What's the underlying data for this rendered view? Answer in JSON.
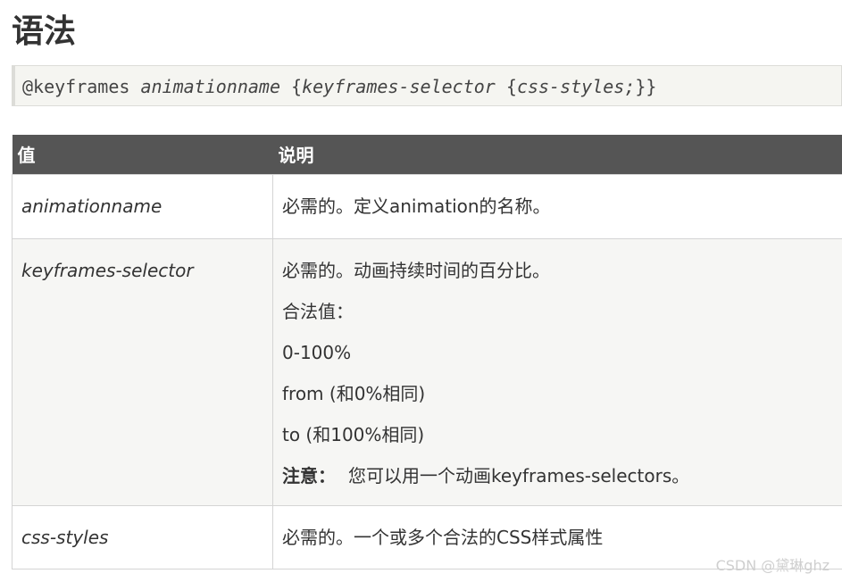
{
  "heading": "语法",
  "code": {
    "prefix": "@keyframes ",
    "name": "animationname",
    "open_brace": " {",
    "selector": "keyframes-selector",
    "inner_open": " {",
    "styles": "css-styles;",
    "close": "}}"
  },
  "table": {
    "headers": [
      "值",
      "说明"
    ],
    "rows": [
      {
        "value": "animationname",
        "desc": [
          "必需的。定义animation的名称。"
        ]
      },
      {
        "value": "keyframes-selector",
        "desc": [
          "必需的。动画持续时间的百分比。",
          "合法值：",
          "0-100%",
          "from (和0%相同)",
          "to (和100%相同)"
        ],
        "note_label": "注意：",
        "note_text": "您可以用一个动画keyframes-selectors。"
      },
      {
        "value": "css-styles",
        "desc": [
          "必需的。一个或多个合法的CSS样式属性"
        ]
      }
    ]
  },
  "watermark": "CSDN @黛琳ghz"
}
